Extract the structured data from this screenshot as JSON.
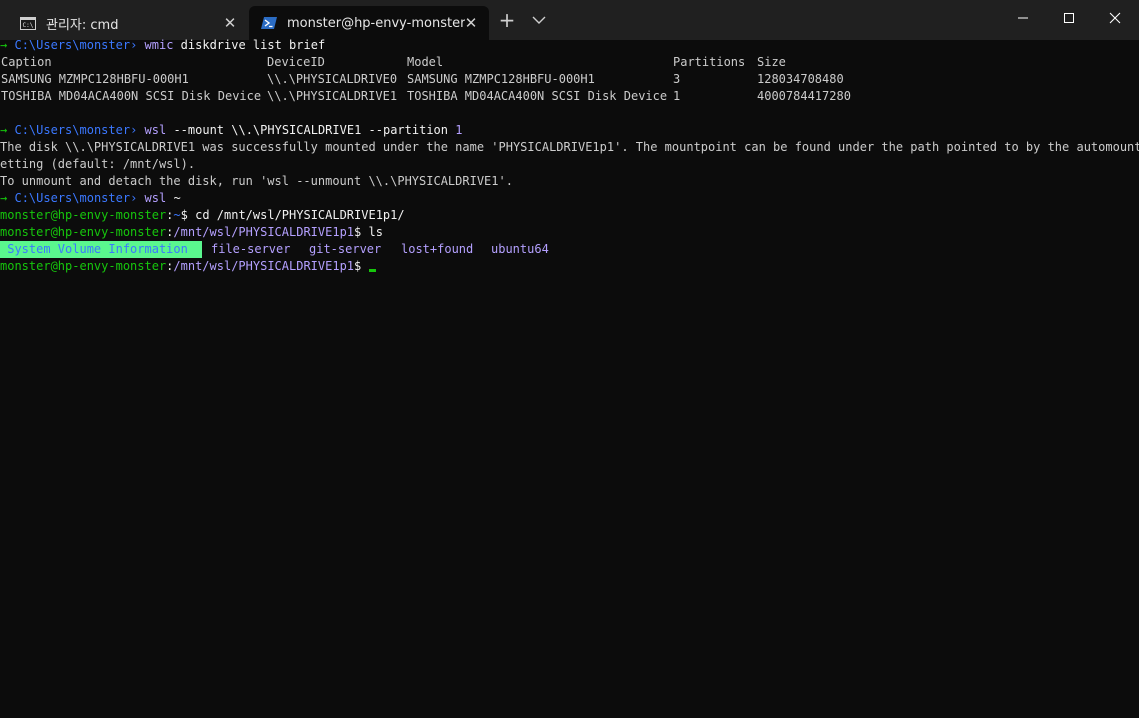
{
  "tabs": [
    {
      "label": "관리자: cmd",
      "icon": "cmd-icon"
    },
    {
      "label": "monster@hp-envy-monster: /n",
      "icon": "powershell-icon"
    }
  ],
  "terminal": {
    "cmd1": {
      "arrow": "→",
      "path": "C:\\Users\\monster",
      "sep": "›",
      "cmd": "wmic",
      "args": "diskdrive list brief"
    },
    "table": {
      "headers": [
        "Caption",
        "DeviceID",
        "Model",
        "Partitions",
        "Size"
      ],
      "rows": [
        [
          "SAMSUNG MZMPC128HBFU-000H1",
          "\\\\.\\PHYSICALDRIVE0",
          "SAMSUNG MZMPC128HBFU-000H1",
          "3",
          "128034708480"
        ],
        [
          "TOSHIBA MD04ACA400N SCSI Disk Device",
          "\\\\.\\PHYSICALDRIVE1",
          "TOSHIBA MD04ACA400N SCSI Disk Device",
          "1",
          "4000784417280"
        ]
      ]
    },
    "cmd2": {
      "arrow": "→",
      "path": "C:\\Users\\monster",
      "sep": "›",
      "cmd": "wsl",
      "args": "--mount \\\\.\\PHYSICALDRIVE1 --partition",
      "num": "1"
    },
    "output": [
      "The disk \\\\.\\PHYSICALDRIVE1 was successfully mounted under the name 'PHYSICALDRIVE1p1'. The mountpoint can be found under the path pointed to by the automount s",
      "etting (default: /mnt/wsl).",
      "To unmount and detach the disk, run 'wsl --unmount \\\\.\\PHYSICALDRIVE1'."
    ],
    "cmd3": {
      "arrow": "→",
      "path": "C:\\Users\\monster",
      "sep": "›",
      "cmd": "wsl",
      "args": "~"
    },
    "bash1": {
      "user": "monster@hp-envy-monster",
      "path": "~",
      "cmd": "cd /mnt/wsl/PHYSICALDRIVE1p1/"
    },
    "bash2": {
      "user": "monster@hp-envy-monster",
      "path": "/mnt/wsl/PHYSICALDRIVE1p1",
      "cmd": "ls"
    },
    "ls": [
      "System Volume Information",
      "file-server",
      "git-server",
      "lost+found",
      "ubuntu64"
    ],
    "bash3": {
      "user": "monster@hp-envy-monster",
      "path": "/mnt/wsl/PHYSICALDRIVE1p1"
    }
  },
  "colors": {
    "background": "#0c0c0c",
    "prompt_green": "#16c60c",
    "path_blue": "#3b78ff",
    "dir_purple": "#b4a0ff",
    "highlight_green": "#5af78e"
  }
}
